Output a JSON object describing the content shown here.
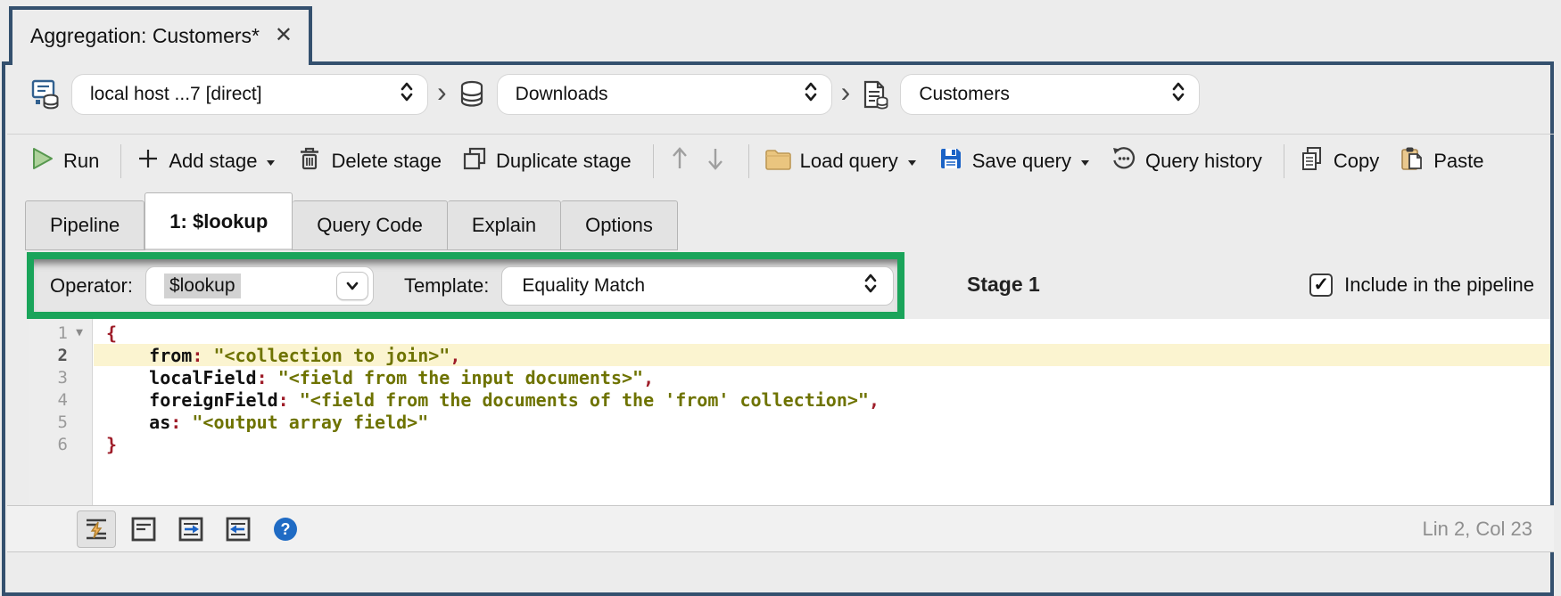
{
  "colors": {
    "navy": "#34506e",
    "green": "#1aa45a",
    "selection": "#d2d2d2",
    "line_highlight": "#fbf4d0",
    "syntax": {
      "key": "#111111",
      "punct": "#9e1c28",
      "string": "#6e7300"
    }
  },
  "tab": {
    "title": "Aggregation: Customers*",
    "close_glyph": "✕"
  },
  "breadcrumb": {
    "separator": "›",
    "connection": "local host ...7 [direct]",
    "database": "Downloads",
    "collection": "Customers"
  },
  "toolbar": {
    "run": "Run",
    "add_stage": "Add stage",
    "delete_stage": "Delete stage",
    "duplicate_stage": "Duplicate stage",
    "load_query": "Load query",
    "save_query": "Save query",
    "query_history": "Query history",
    "copy": "Copy",
    "paste": "Paste"
  },
  "tabs": [
    {
      "label": "Pipeline",
      "active": false
    },
    {
      "label": "1: $lookup",
      "active": true
    },
    {
      "label": "Query Code",
      "active": false
    },
    {
      "label": "Explain",
      "active": false
    },
    {
      "label": "Options",
      "active": false
    }
  ],
  "stage_header": {
    "operator_label": "Operator:",
    "operator_value": "$lookup",
    "template_label": "Template:",
    "template_value": "Equality Match",
    "stage_label": "Stage 1",
    "include_label": "Include in the pipeline",
    "include_checked": true,
    "check_glyph": "✓"
  },
  "editor": {
    "fold_glyph": "▼",
    "status": "Lin 2, Col 23",
    "lines": [
      {
        "num": "1",
        "fold": true,
        "segments": [
          {
            "t": "{",
            "c": "punct"
          }
        ]
      },
      {
        "num": "2",
        "current": true,
        "segments": [
          {
            "t": "    ",
            "c": "plain"
          },
          {
            "t": "from",
            "c": "key"
          },
          {
            "t": ":",
            "c": "punct"
          },
          {
            "t": " ",
            "c": "plain"
          },
          {
            "t": "\"<collection to join>\"",
            "c": "string"
          },
          {
            "t": ",",
            "c": "punct"
          }
        ]
      },
      {
        "num": "3",
        "segments": [
          {
            "t": "    ",
            "c": "plain"
          },
          {
            "t": "localField",
            "c": "key"
          },
          {
            "t": ":",
            "c": "punct"
          },
          {
            "t": " ",
            "c": "plain"
          },
          {
            "t": "\"<field from the input documents>\"",
            "c": "string"
          },
          {
            "t": ",",
            "c": "punct"
          }
        ]
      },
      {
        "num": "4",
        "segments": [
          {
            "t": "    ",
            "c": "plain"
          },
          {
            "t": "foreignField",
            "c": "key"
          },
          {
            "t": ":",
            "c": "punct"
          },
          {
            "t": " ",
            "c": "plain"
          },
          {
            "t": "\"<field from the documents of the 'from' collection>\"",
            "c": "string"
          },
          {
            "t": ",",
            "c": "punct"
          }
        ]
      },
      {
        "num": "5",
        "segments": [
          {
            "t": "    ",
            "c": "plain"
          },
          {
            "t": "as",
            "c": "key"
          },
          {
            "t": ":",
            "c": "punct"
          },
          {
            "t": " ",
            "c": "plain"
          },
          {
            "t": "\"<output array field>\"",
            "c": "string"
          }
        ]
      },
      {
        "num": "6",
        "segments": [
          {
            "t": "}",
            "c": "punct"
          }
        ]
      }
    ]
  }
}
